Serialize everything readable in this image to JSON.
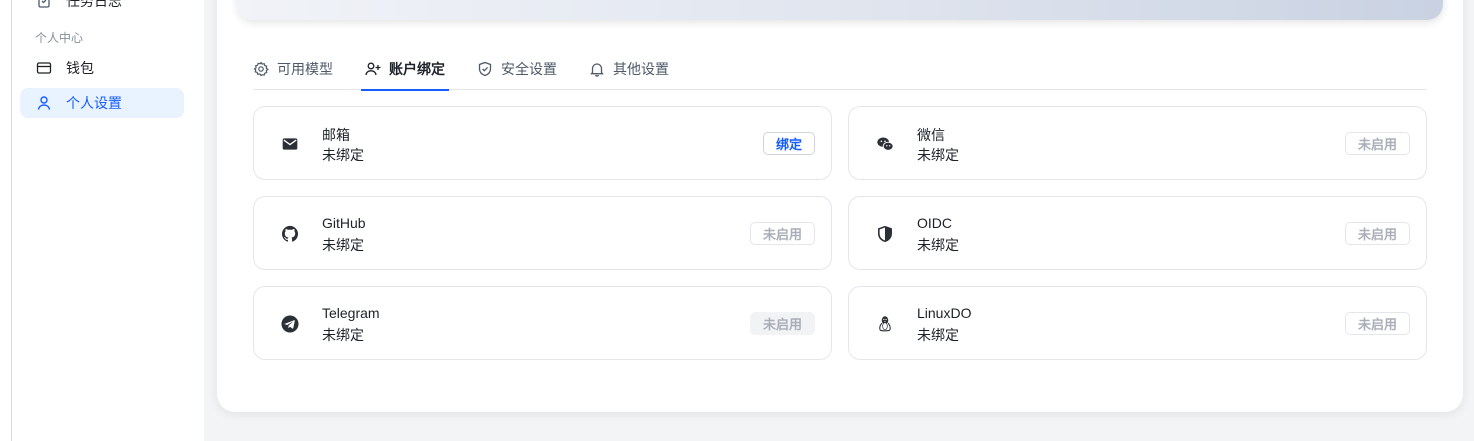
{
  "sidebar": {
    "items": [
      {
        "label": "任务日志",
        "icon": "task-log-icon"
      },
      {
        "label": "钱包",
        "icon": "wallet-icon"
      },
      {
        "label": "个人设置",
        "icon": "user-icon"
      }
    ],
    "group_label": "个人中心"
  },
  "tabs": [
    {
      "label": "可用模型",
      "icon": "gear-icon"
    },
    {
      "label": "账户绑定",
      "icon": "user-plus-icon",
      "active": true
    },
    {
      "label": "安全设置",
      "icon": "shield-icon"
    },
    {
      "label": "其他设置",
      "icon": "bell-icon"
    }
  ],
  "bindings": [
    {
      "name": "邮箱",
      "status": "未绑定",
      "action": "绑定",
      "icon": "mail-icon"
    },
    {
      "name": "微信",
      "status": "未绑定",
      "action": "未启用",
      "icon": "wechat-icon"
    },
    {
      "name": "GitHub",
      "status": "未绑定",
      "action": "未启用",
      "icon": "github-icon"
    },
    {
      "name": "OIDC",
      "status": "未绑定",
      "action": "未启用",
      "icon": "oidc-shield-icon"
    },
    {
      "name": "Telegram",
      "status": "未绑定",
      "action": "未启用",
      "icon": "telegram-icon"
    },
    {
      "name": "LinuxDO",
      "status": "未绑定",
      "action": "未启用",
      "icon": "linux-penguin-icon"
    }
  ],
  "colors": {
    "accent": "#165dff",
    "active_bg": "#e8f3ff"
  }
}
